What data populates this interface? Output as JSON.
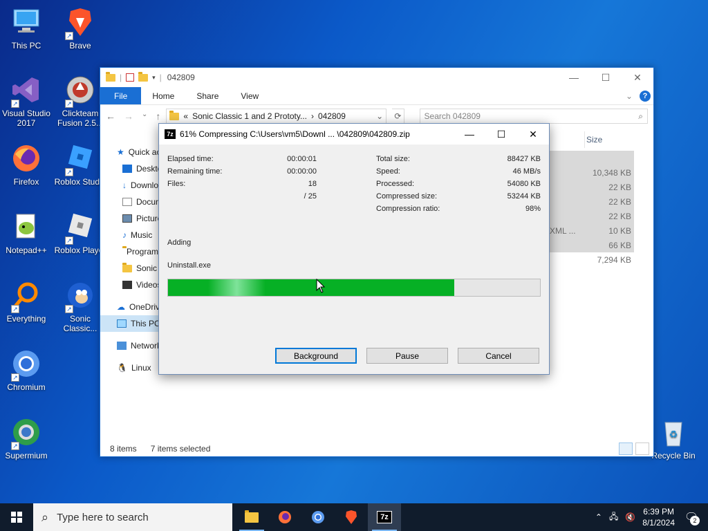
{
  "desktop": {
    "icons": [
      {
        "label": "This PC",
        "icon": "computer-icon"
      },
      {
        "label": "Brave",
        "icon": "brave-icon"
      },
      {
        "label": "Visual Studio 2017",
        "icon": "visual-studio-icon"
      },
      {
        "label": "Clickteam Fusion 2.5...",
        "icon": "clickteam-icon"
      },
      {
        "label": "Firefox",
        "icon": "firefox-icon"
      },
      {
        "label": "Roblox Studio",
        "icon": "roblox-studio-icon"
      },
      {
        "label": "Notepad++",
        "icon": "notepadpp-icon"
      },
      {
        "label": "Roblox Player",
        "icon": "roblox-player-icon"
      },
      {
        "label": "Everything",
        "icon": "everything-icon"
      },
      {
        "label": "Sonic Classic...",
        "icon": "sonic-icon"
      },
      {
        "label": "Chromium",
        "icon": "chromium-icon"
      },
      {
        "label": "Supermium",
        "icon": "supermium-icon"
      },
      {
        "label": "Recycle Bin",
        "icon": "recycle-bin-icon"
      }
    ]
  },
  "explorer": {
    "title": "042809",
    "ribbon": {
      "file": "File",
      "home": "Home",
      "share": "Share",
      "view": "View",
      "help": "?"
    },
    "address": {
      "prefix": "«",
      "segment1": "Sonic Classic 1 and 2 Prototy...",
      "sep": "›",
      "segment2": "042809"
    },
    "search_placeholder": "Search 042809",
    "nav": [
      {
        "label": "Quick access",
        "icon": "star-icon"
      },
      {
        "label": "Desktop",
        "icon": "desktop-icon"
      },
      {
        "label": "Downloads",
        "icon": "download-icon"
      },
      {
        "label": "Documents",
        "icon": "document-icon"
      },
      {
        "label": "Pictures",
        "icon": "pictures-icon"
      },
      {
        "label": "Music",
        "icon": "music-icon"
      },
      {
        "label": "Programs",
        "icon": "folder-icon"
      },
      {
        "label": "Sonic",
        "icon": "folder-icon"
      },
      {
        "label": "Videos",
        "icon": "video-icon"
      },
      {
        "label": "OneDrive",
        "icon": "cloud-icon"
      },
      {
        "label": "This PC",
        "icon": "computer-icon"
      },
      {
        "label": "Network",
        "icon": "network-icon"
      },
      {
        "label": "Linux",
        "icon": "linux-icon"
      }
    ],
    "column_size": "Size",
    "rows": [
      {
        "type": "",
        "size": ""
      },
      {
        "type": "",
        "size": "10,348 KB"
      },
      {
        "type": "",
        "size": "22 KB"
      },
      {
        "type": "",
        "size": "22 KB"
      },
      {
        "type": "",
        "size": "22 KB"
      },
      {
        "type": "XML ...",
        "size": "10 KB"
      },
      {
        "type": "",
        "size": "66 KB"
      },
      {
        "type": "",
        "size": "7,294 KB"
      }
    ],
    "status_items": "8 items",
    "status_selected": "7 items selected"
  },
  "zip": {
    "logo": "7z",
    "title": "61% Compressing C:\\Users\\vm5\\Downl ... \\042809\\042809.zip",
    "elapsed_label": "Elapsed time:",
    "elapsed": "00:00:01",
    "remaining_label": "Remaining time:",
    "remaining": "00:00:00",
    "files_label": "Files:",
    "files": "18",
    "files_total": "/ 25",
    "total_label": "Total size:",
    "total": "88427 KB",
    "speed_label": "Speed:",
    "speed": "46 MB/s",
    "processed_label": "Processed:",
    "processed": "54080 KB",
    "compressed_label": "Compressed size:",
    "compressed": "53244 KB",
    "ratio_label": "Compression ratio:",
    "ratio": "98%",
    "action": "Adding",
    "current_file": "Uninstall.exe",
    "progress": 0.77,
    "background_btn": "Background",
    "pause_btn": "Pause",
    "cancel_btn": "Cancel"
  },
  "taskbar": {
    "search_placeholder": "Type here to search",
    "apps": [
      "file-explorer-icon",
      "firefox-icon",
      "chromium-icon",
      "brave-icon",
      "7zip-icon"
    ],
    "time": "6:39 PM",
    "date": "8/1/2024",
    "notifications": "2"
  }
}
